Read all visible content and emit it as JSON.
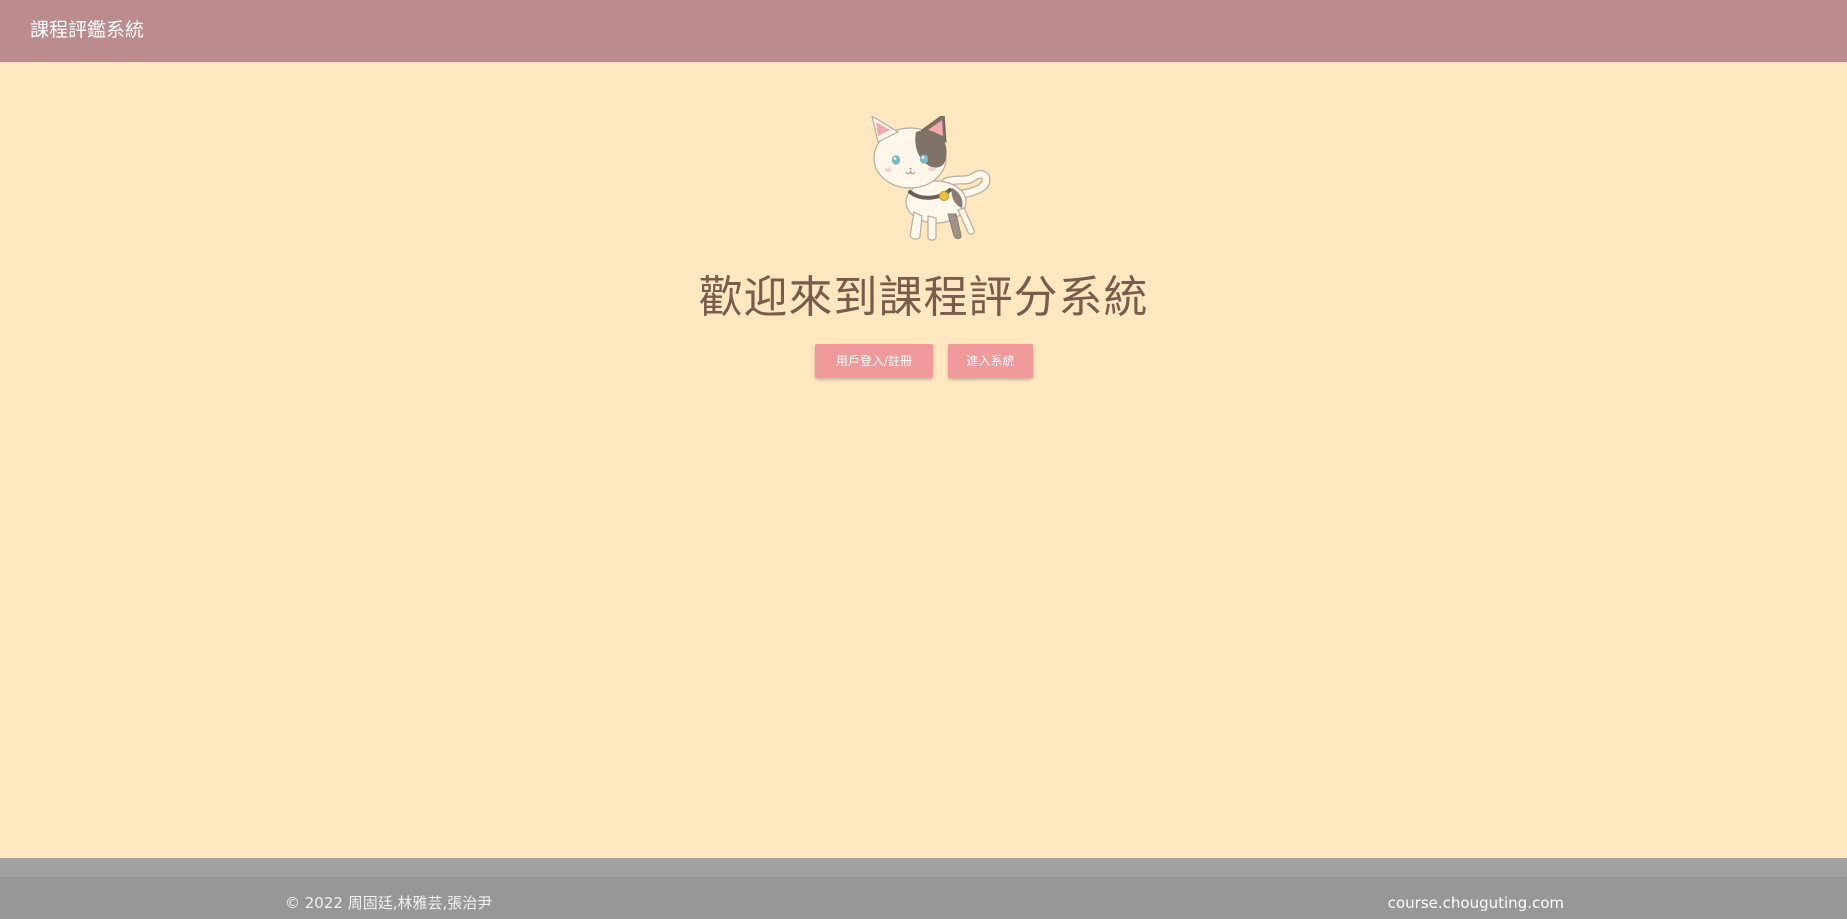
{
  "navbar": {
    "brand": "課程評鑑系統"
  },
  "hero": {
    "image": "cat-illustration",
    "headline": "歡迎來到課程評分系統",
    "buttons": {
      "login_label": "用戶登入/註冊",
      "enter_label": "進入系統"
    }
  },
  "footer": {
    "copyright": "© 2022 周固廷,林雅芸,張治尹",
    "site": "course.chouguting.com"
  },
  "colors": {
    "navbar": "#bc8b8e",
    "page_background": "#ffe8bf",
    "headline": "#7a5b4c",
    "button": "#f19a9b",
    "footer": "#979797"
  }
}
